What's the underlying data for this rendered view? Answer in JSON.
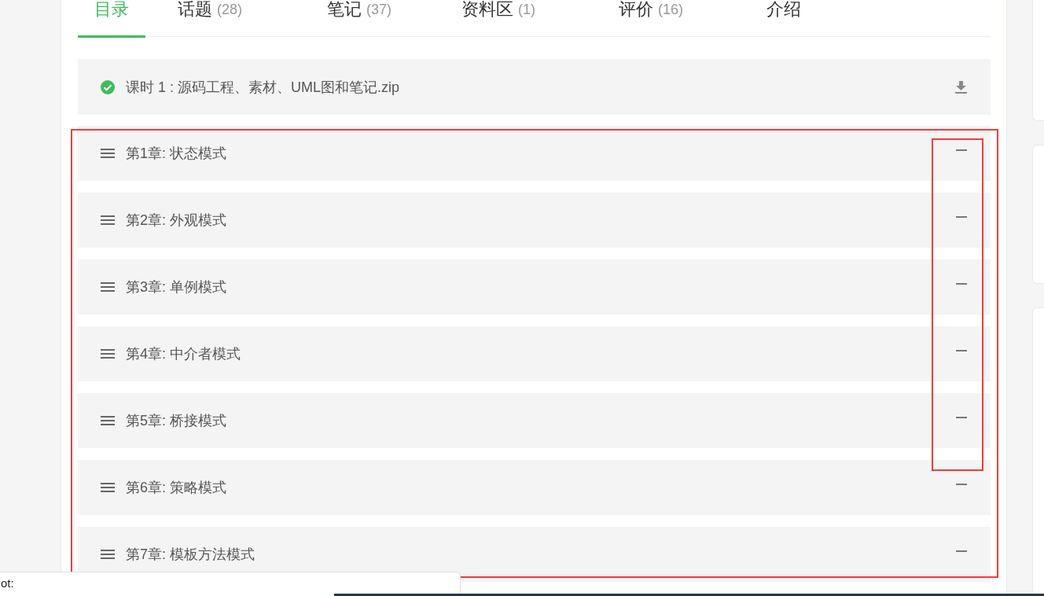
{
  "tabs": [
    {
      "label": "目录",
      "selected": true
    },
    {
      "label": "话题",
      "count": "(28)",
      "selected": false
    },
    {
      "label": "笔记",
      "count": "(37)",
      "selected": false
    },
    {
      "label": "资料区",
      "count": "(1)",
      "selected": false
    },
    {
      "label": "评价",
      "count": "(16)",
      "selected": false
    },
    {
      "label": "介绍",
      "selected": false
    }
  ],
  "resource": {
    "title": "课时 1 : 源码工程、素材、UML图和笔记.zip",
    "completed": true
  },
  "chapters": [
    {
      "title": "第1章: 状态模式"
    },
    {
      "title": "第2章: 外观模式"
    },
    {
      "title": "第3章: 单例模式"
    },
    {
      "title": "第4章: 中介者模式"
    },
    {
      "title": "第5章: 桥接模式"
    },
    {
      "title": "第6章: 策略模式"
    },
    {
      "title": "第7章: 模板方法模式"
    }
  ],
  "status_bar": {
    "text": "ot:"
  }
}
